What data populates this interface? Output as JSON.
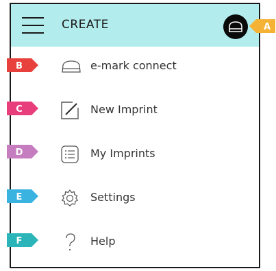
{
  "header": {
    "title": "CREATE",
    "menu_icon": "hamburger-menu-icon",
    "device_icon": "emark-device-icon"
  },
  "menu": [
    {
      "id": "emark-connect",
      "label": "e-mark connect",
      "icon": "emark-device-icon"
    },
    {
      "id": "new-imprint",
      "label": "New Imprint",
      "icon": "pencil-square-icon"
    },
    {
      "id": "my-imprints",
      "label": "My Imprints",
      "icon": "list-icon"
    },
    {
      "id": "settings",
      "label": "Settings",
      "icon": "gear-icon"
    },
    {
      "id": "help",
      "label": "Help",
      "icon": "question-mark-icon"
    }
  ],
  "callouts": [
    {
      "letter": "A",
      "color": "#f5b335"
    },
    {
      "letter": "B",
      "color": "#e8413d"
    },
    {
      "letter": "C",
      "color": "#e83f7c"
    },
    {
      "letter": "D",
      "color": "#c67dbf"
    },
    {
      "letter": "E",
      "color": "#3ab3e0"
    },
    {
      "letter": "F",
      "color": "#2bb5b8"
    }
  ],
  "colors": {
    "header_bg": "#b3ecec",
    "border": "#1a1a1a",
    "text": "#333333"
  }
}
